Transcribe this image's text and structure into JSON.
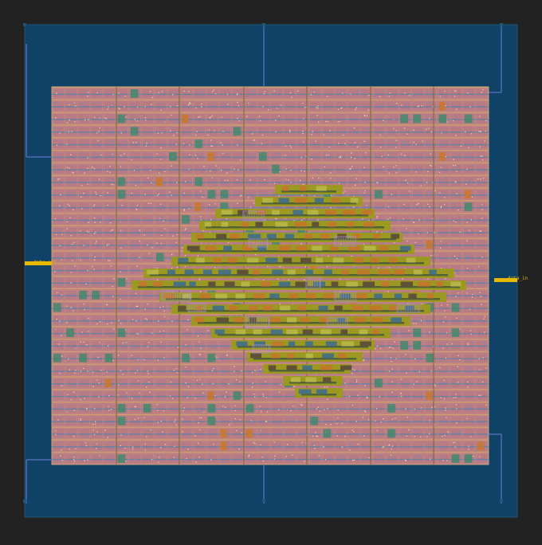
{
  "viewer": {
    "background_color": "#222222",
    "die_color": "#0f4266",
    "core_fill_color": "#b87a83",
    "row_stripe_color": "#5b7fa8",
    "power_rail_color": "#d3a56c",
    "cluster_color": "#9a9a1c",
    "cluster_dark_color": "#4a5c3a",
    "pin_color": "#e6b800",
    "route_color": "#6f7fd8"
  },
  "pins": {
    "data_out": "data_out",
    "data_in": "data_in"
  },
  "corner_labels": {
    "top_left": "",
    "top_center": "",
    "bottom_left": "",
    "bottom_center": "",
    "bottom_right": ""
  },
  "layout": {
    "row_count": 30,
    "cell_column_count": 34,
    "placement_density": 0.92
  }
}
